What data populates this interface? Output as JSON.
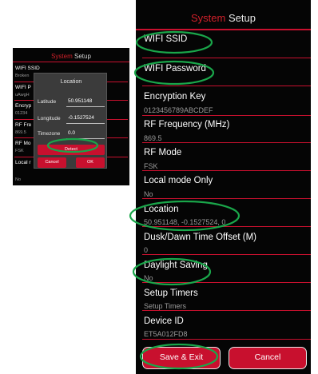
{
  "small_screen": {
    "title_accent": "System",
    "title_rest": "Setup",
    "items": [
      {
        "label": "WIFI SSID",
        "value": "Broken"
      },
      {
        "label": "WIFI P",
        "value": "uAwgH"
      },
      {
        "label": "Encryp",
        "value": "01234"
      },
      {
        "label": "RF Fre",
        "value": "869.5"
      },
      {
        "label": "RF Mo",
        "value": "FSK"
      },
      {
        "label": "Local r",
        "value": "No"
      }
    ],
    "dialog": {
      "title": "Location",
      "latitude_label": "Latitude",
      "latitude_value": "50.951148",
      "longitude_label": "Longitude",
      "longitude_value": "-0.1527524",
      "timezone_label": "Timezone",
      "timezone_value": "0.0",
      "detect_label": "Detect",
      "cancel_label": "Cancel",
      "ok_label": "OK"
    }
  },
  "main_screen": {
    "title_accent": "System",
    "title_rest": "Setup",
    "settings": [
      {
        "label": "WIFI SSID",
        "value": ""
      },
      {
        "label": "WIFI Password",
        "value": ""
      },
      {
        "label": "Encryption Key",
        "value": "0123456789ABCDEF"
      },
      {
        "label": "RF Frequency (MHz)",
        "value": "869.5"
      },
      {
        "label": "RF Mode",
        "value": "FSK"
      },
      {
        "label": "Local mode Only",
        "value": "No"
      },
      {
        "label": "Location",
        "value": "50.951148, -0.1527524, 0"
      },
      {
        "label": "Dusk/Dawn Time Offset (M)",
        "value": "0"
      },
      {
        "label": "Daylight Saving",
        "value": "No"
      },
      {
        "label": "Setup Timers",
        "value": "Setup Timers"
      },
      {
        "label": "Device ID",
        "value": "ET5A012FD8"
      }
    ],
    "save_label": "Save & Exit",
    "cancel_label": "Cancel"
  },
  "colors": {
    "accent": "#c8102e",
    "background": "#050505",
    "highlight": "#1aa64a"
  }
}
